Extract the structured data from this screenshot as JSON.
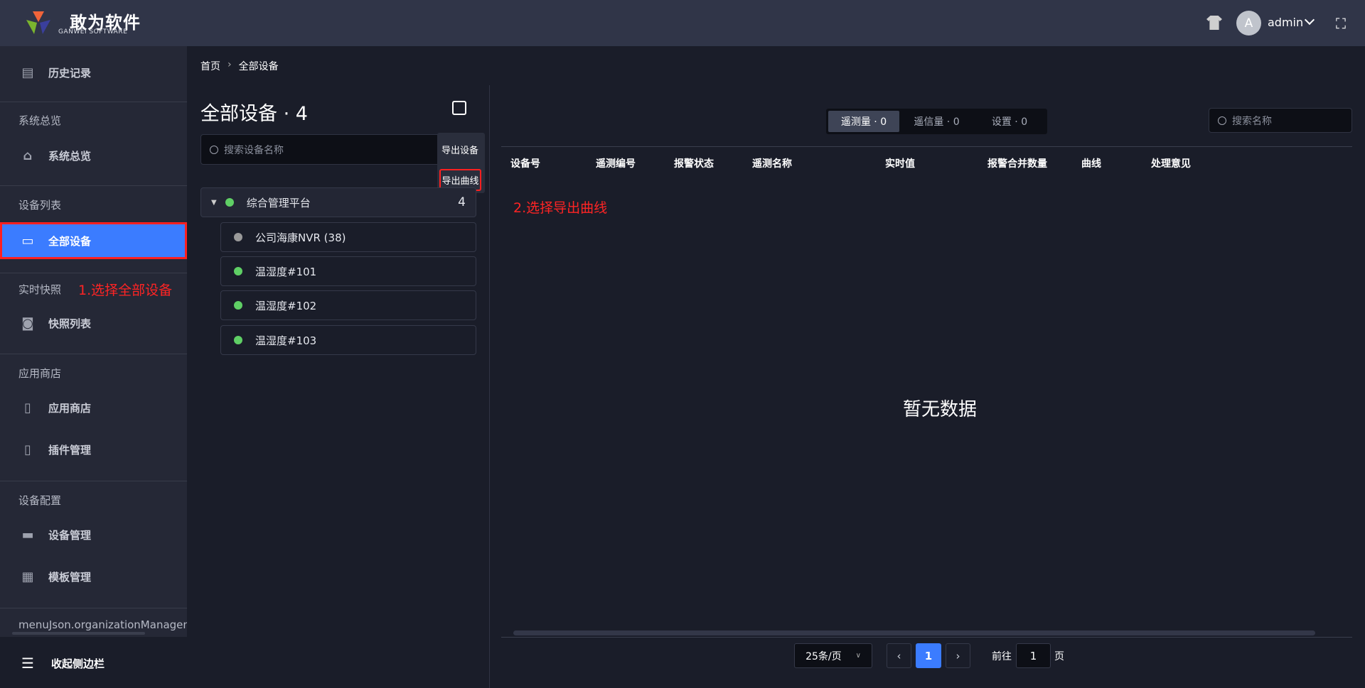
{
  "header": {
    "brand": "敢为软件",
    "brand_sub": "GANWEI SOFTWARE",
    "avatar_letter": "A",
    "username": "admin"
  },
  "sidebar": {
    "history": "历史记录",
    "sections": [
      {
        "label": "系统总览",
        "items": [
          "系统总览"
        ]
      },
      {
        "label": "设备列表",
        "items": [
          "全部设备"
        ]
      },
      {
        "label": "实时快照",
        "items": [
          "快照列表"
        ]
      },
      {
        "label": "应用商店",
        "items": [
          "应用商店",
          "插件管理"
        ]
      },
      {
        "label": "设备配置",
        "items": [
          "设备管理",
          "模板管理"
        ]
      },
      {
        "label": "menuJson.organizationManagement"
      }
    ],
    "collapse": "收起侧边栏",
    "annotation": "1.选择全部设备"
  },
  "breadcrumb": [
    "首页",
    "全部设备"
  ],
  "device_panel": {
    "title": "全部设备 · 4",
    "search_placeholder": "搜索设备名称",
    "popover": [
      "导出设备",
      "导出曲线"
    ],
    "root": {
      "name": "综合管理平台",
      "count": "4"
    },
    "children": [
      {
        "name": "公司海康NVR (38)",
        "status_color": "#9a9a9a"
      },
      {
        "name": "温湿度#101",
        "status_color": "#5fcf65"
      },
      {
        "name": "温湿度#102",
        "status_color": "#5fcf65"
      },
      {
        "name": "温湿度#103",
        "status_color": "#5fcf65"
      }
    ]
  },
  "point_panel": {
    "tabs": [
      "遥测量 · 0",
      "遥信量 · 0",
      "设置 · 0"
    ],
    "search_placeholder": "搜索名称",
    "columns": [
      "设备号",
      "遥测编号",
      "报警状态",
      "遥测名称",
      "实时值",
      "报警合并数量",
      "曲线",
      "处理意见"
    ],
    "annotation": "2.选择导出曲线",
    "empty": "暂无数据",
    "pagination": {
      "page_size": "25条/页",
      "current": "1",
      "goto_label": "前往",
      "goto_value": "1",
      "page_suffix": "页"
    }
  }
}
